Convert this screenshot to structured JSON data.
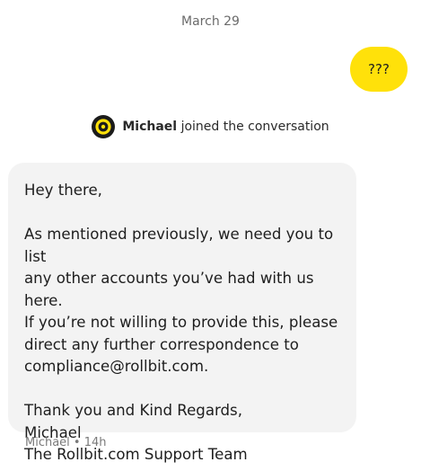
{
  "conversation": {
    "date_divider": "March 29",
    "outgoing_message": "???",
    "system_event": {
      "agent_name": "Michael",
      "event_text": "joined the conversation",
      "avatar_color": "#ffe10a"
    },
    "incoming_message": {
      "greeting": "Hey there,",
      "body_lines": [
        "As mentioned previously, we need you to list",
        "any other accounts you’ve had with us here.",
        "If you’re not willing to provide this, please",
        "direct any further correspondence to",
        "compliance@rollbit.com."
      ],
      "signoff_lines": [
        "Thank you and Kind Regards,",
        "Michael",
        "The Rollbit.com Support Team"
      ]
    },
    "incoming_meta": "Michael • 14h"
  },
  "colors": {
    "outgoing_bubble": "#ffe10a",
    "incoming_bubble": "#f3f3f3",
    "muted_text": "#6b6b6b"
  }
}
